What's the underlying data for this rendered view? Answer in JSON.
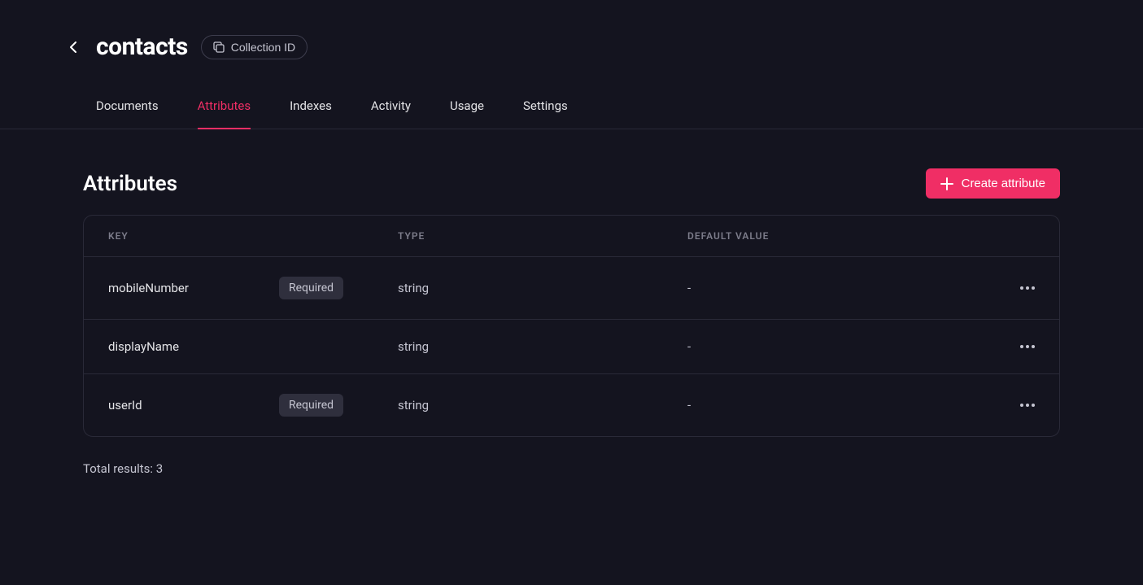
{
  "header": {
    "title": "contacts",
    "collection_id_label": "Collection ID"
  },
  "tabs": [
    {
      "label": "Documents",
      "active": false
    },
    {
      "label": "Attributes",
      "active": true
    },
    {
      "label": "Indexes",
      "active": false
    },
    {
      "label": "Activity",
      "active": false
    },
    {
      "label": "Usage",
      "active": false
    },
    {
      "label": "Settings",
      "active": false
    }
  ],
  "content": {
    "title": "Attributes",
    "create_button": "Create attribute"
  },
  "table": {
    "columns": {
      "key": "KEY",
      "type": "TYPE",
      "default": "DEFAULT VALUE"
    },
    "rows": [
      {
        "key": "mobileNumber",
        "required": true,
        "required_label": "Required",
        "type": "string",
        "default": "-"
      },
      {
        "key": "displayName",
        "required": false,
        "required_label": "",
        "type": "string",
        "default": "-"
      },
      {
        "key": "userId",
        "required": true,
        "required_label": "Required",
        "type": "string",
        "default": "-"
      }
    ]
  },
  "footer": {
    "total_results": "Total results: 3"
  }
}
